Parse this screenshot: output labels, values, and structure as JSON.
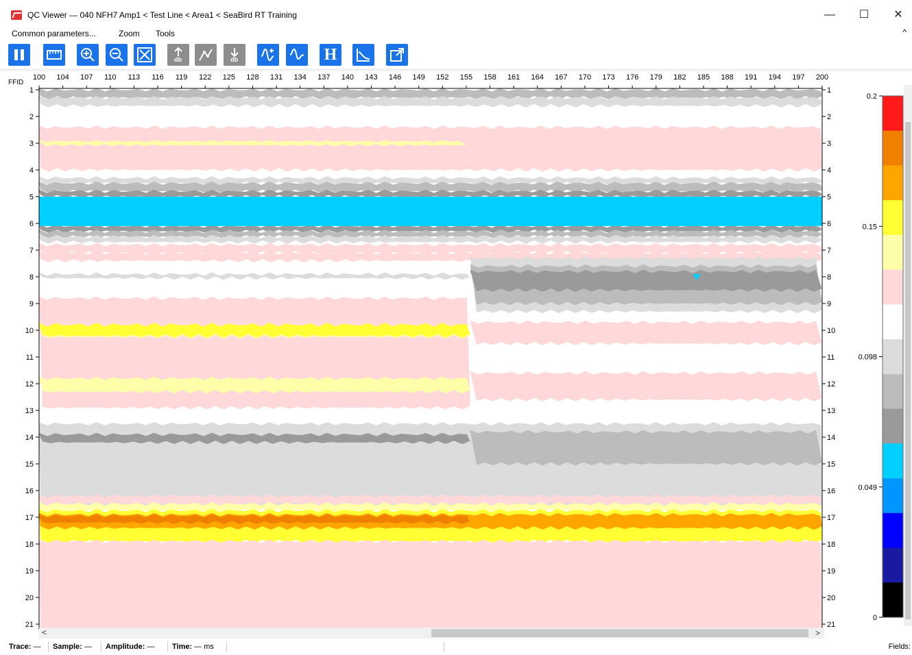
{
  "window": {
    "title": "QC Viewer — 040 NFH7 Amp1 < Test Line < Area1 < SeaBird RT Training",
    "minimize": "—",
    "maximize": "☐",
    "close": "✕"
  },
  "menu": {
    "items": [
      "Common parameters...",
      "Zoom",
      "Tools"
    ],
    "collapse": "^"
  },
  "toolbar": {
    "buttons": [
      {
        "name": "pause-icon",
        "color": "blue"
      },
      {
        "name": "ruler-icon",
        "color": "blue"
      },
      {
        "name": "zoom-in-icon",
        "color": "blue"
      },
      {
        "name": "zoom-out-icon",
        "color": "blue"
      },
      {
        "name": "fit-view-icon",
        "color": "blue"
      },
      {
        "name": "db-arrow-up-icon",
        "color": "grey"
      },
      {
        "name": "curve-node-icon",
        "color": "grey"
      },
      {
        "name": "db-arrow-down-icon",
        "color": "grey"
      },
      {
        "name": "wave-plus-icon",
        "color": "blue"
      },
      {
        "name": "wave-icon",
        "color": "blue"
      },
      {
        "name": "header-h-icon",
        "color": "blue"
      },
      {
        "name": "spectrum-icon",
        "color": "blue"
      },
      {
        "name": "export-icon",
        "color": "blue"
      }
    ],
    "h_label": "H"
  },
  "plot": {
    "x_axis_label": "FFID",
    "x_ticks": [
      "100",
      "104",
      "107",
      "110",
      "113",
      "116",
      "119",
      "122",
      "125",
      "128",
      "131",
      "134",
      "137",
      "140",
      "143",
      "146",
      "149",
      "152",
      "155",
      "158",
      "161",
      "164",
      "167",
      "170",
      "173",
      "176",
      "179",
      "182",
      "185",
      "188",
      "191",
      "194",
      "197",
      "200"
    ],
    "y_ticks": [
      "1",
      "2",
      "3",
      "4",
      "5",
      "6",
      "7",
      "8",
      "9",
      "10",
      "11",
      "12",
      "13",
      "14",
      "15",
      "16",
      "17",
      "18",
      "19",
      "20",
      "21"
    ]
  },
  "colorbar": {
    "labels": [
      "0.2",
      "0.15",
      "0.098",
      "0.049",
      "0"
    ],
    "colors": [
      "#ff1a1a",
      "#f08000",
      "#ffa500",
      "#ffff33",
      "#ffffaa",
      "#ffd8d8",
      "#ffffff",
      "#dcdcdc",
      "#bcbcbc",
      "#9a9a9a",
      "#00cfff",
      "#0096ff",
      "#0000ff",
      "#1a1aa0",
      "#000000"
    ]
  },
  "heatmap_colors": {
    "pink": "#ffd9d9",
    "white": "#ffffff",
    "lightgrey": "#dcdcdc",
    "grey": "#bcbcbc",
    "darkgrey": "#9a9a9a",
    "cyan": "#00cfff",
    "yellow": "#ffff33",
    "lightyellow": "#ffffaa",
    "orange": "#ffa500",
    "darkorange": "#f08000"
  },
  "status": {
    "trace_label": "Trace:",
    "trace_value": "—",
    "sample_label": "Sample:",
    "sample_value": "—",
    "amplitude_label": "Amplitude:",
    "amplitude_value": "—",
    "time_label": "Time:",
    "time_value": "— ms",
    "fields_label": "Fields:"
  }
}
